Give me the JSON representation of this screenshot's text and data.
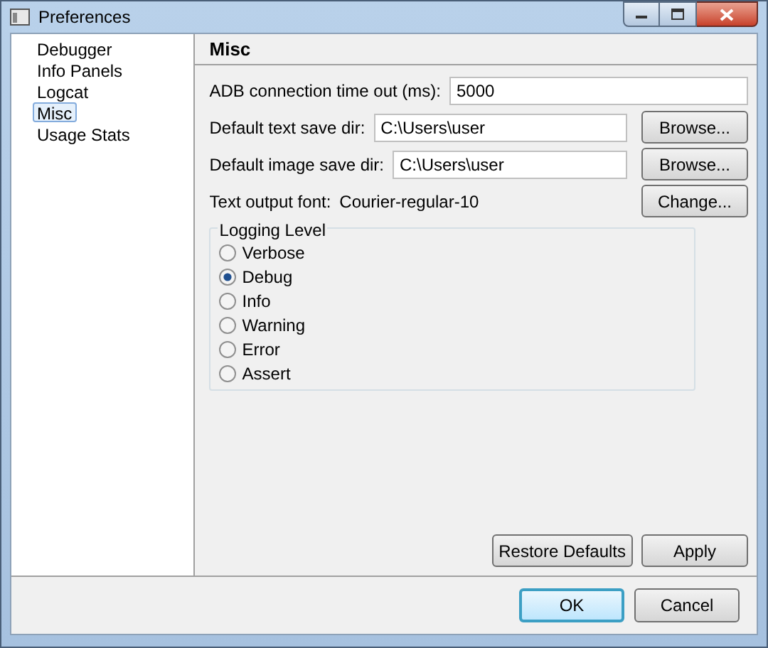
{
  "window": {
    "title": "Preferences"
  },
  "sidebar": {
    "items": [
      {
        "label": "Debugger",
        "selected": false
      },
      {
        "label": "Info Panels",
        "selected": false
      },
      {
        "label": "Logcat",
        "selected": false
      },
      {
        "label": "Misc",
        "selected": true
      },
      {
        "label": "Usage Stats",
        "selected": false
      }
    ]
  },
  "page": {
    "title": "Misc",
    "fields": [
      {
        "kind": "field",
        "label": "ADB connection time out (ms):",
        "value": "5000"
      },
      {
        "kind": "field",
        "label": "Default text save dir:",
        "value": "C:\\Users\\user",
        "button": "Browse..."
      },
      {
        "kind": "field",
        "label": "Default image save dir:",
        "value": "C:\\Users\\user",
        "button": "Browse..."
      },
      {
        "kind": "text",
        "label": "Text output font:",
        "value": "Courier-regular-10",
        "button": "Change..."
      }
    ],
    "logging_level": {
      "title": "Logging Level",
      "options": [
        {
          "label": "Verbose",
          "selected": false
        },
        {
          "label": "Debug",
          "selected": true
        },
        {
          "label": "Info",
          "selected": false
        },
        {
          "label": "Warning",
          "selected": false
        },
        {
          "label": "Error",
          "selected": false
        },
        {
          "label": "Assert",
          "selected": false
        }
      ]
    },
    "buttons": [
      "Restore Defaults",
      "Apply"
    ]
  },
  "footer_buttons": [
    {
      "label": "OK",
      "default": true
    },
    {
      "label": "Cancel",
      "default": false
    }
  ]
}
